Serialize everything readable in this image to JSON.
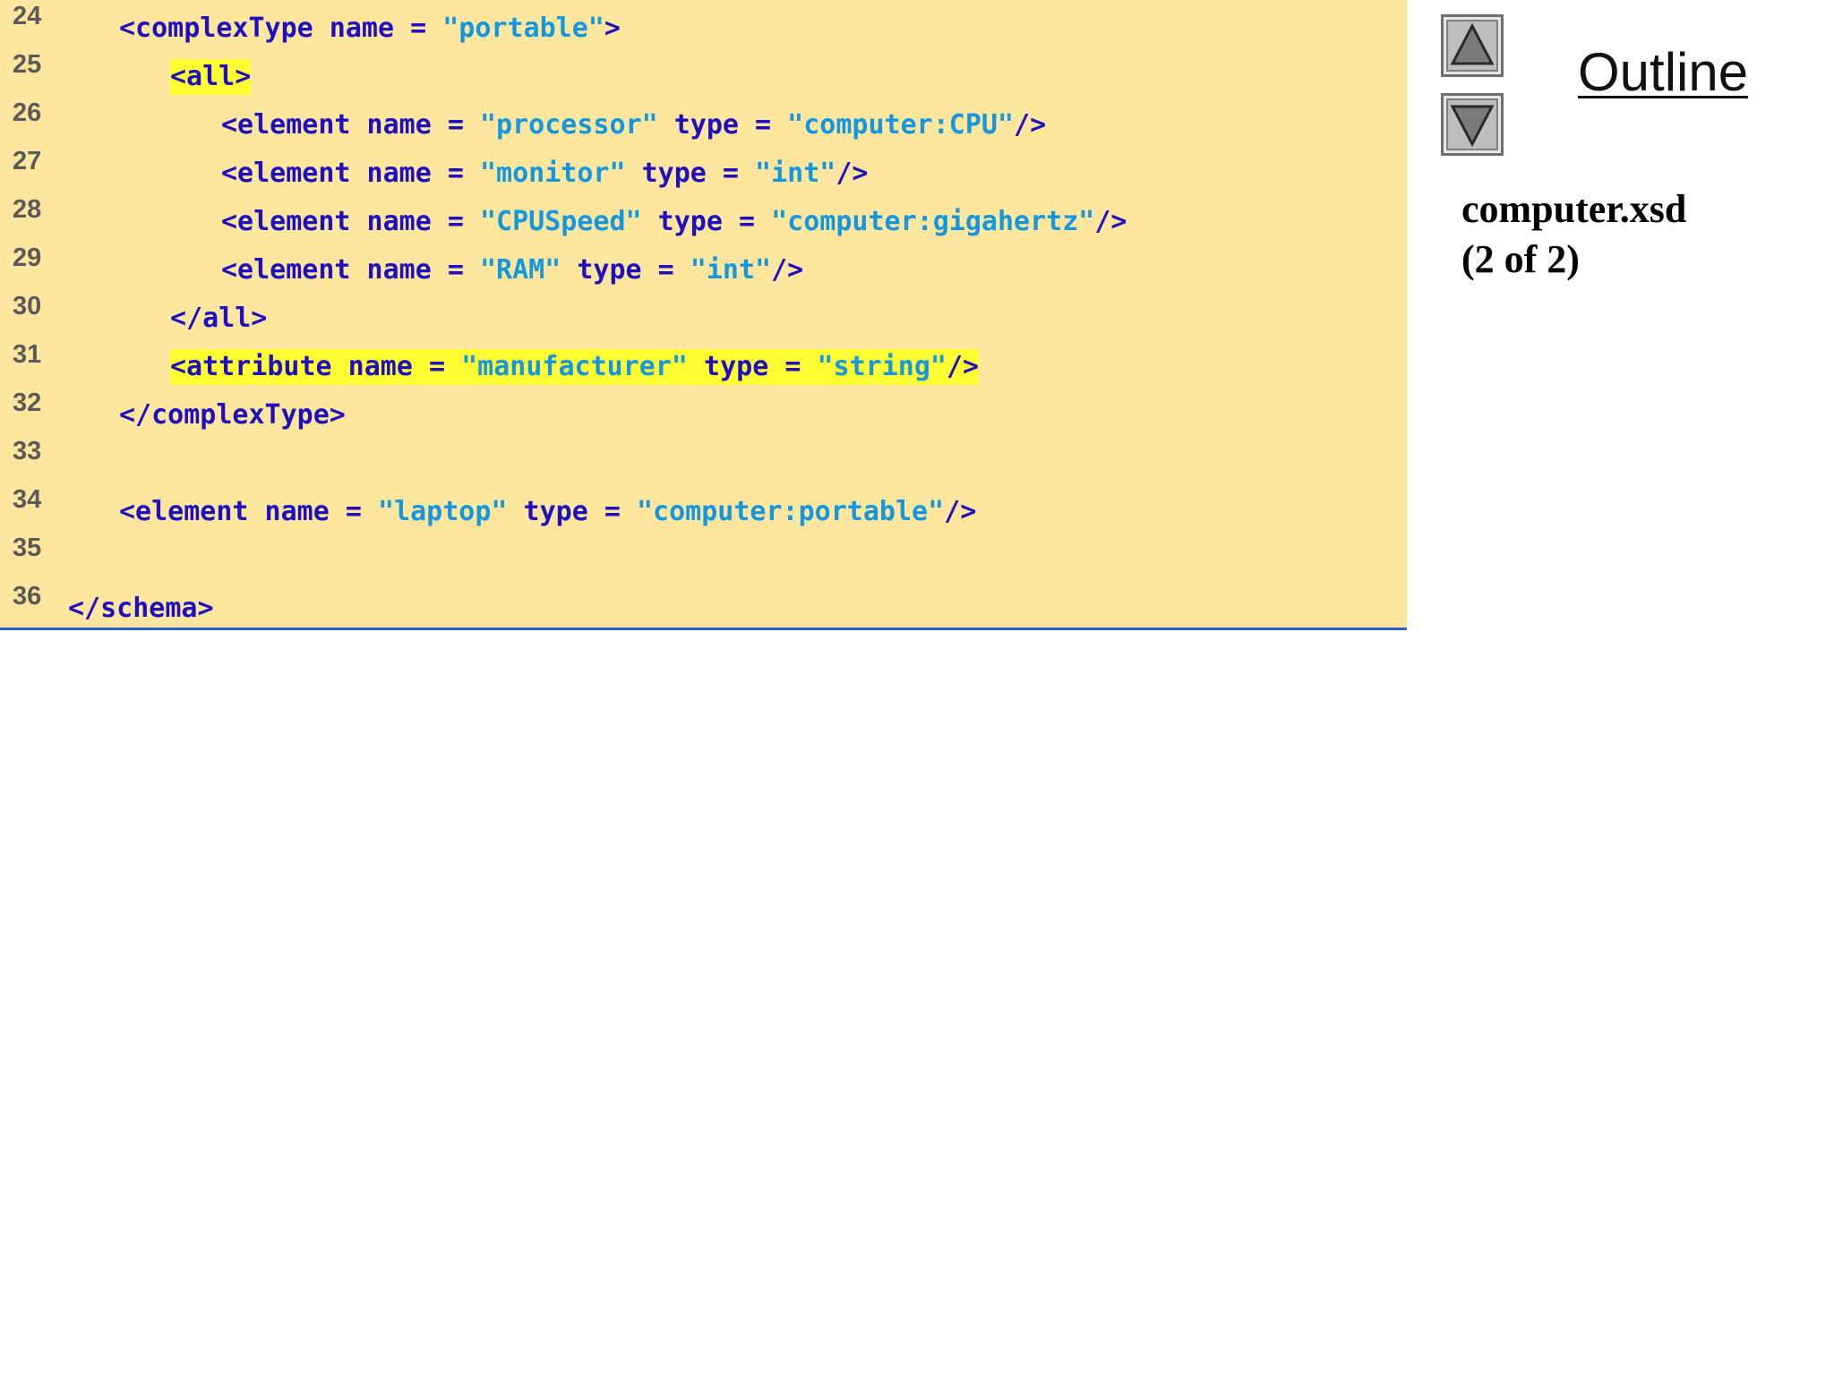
{
  "code": {
    "lines": [
      {
        "number": "24",
        "indent": 1,
        "segments": [
          {
            "t": "<complexType name = ",
            "c": "tag"
          },
          {
            "t": "\"portable\"",
            "c": "val"
          },
          {
            "t": ">",
            "c": "tag"
          }
        ]
      },
      {
        "number": "25",
        "indent": 2,
        "highlight": true,
        "segments": [
          {
            "t": "<all>",
            "c": "tag"
          }
        ]
      },
      {
        "number": "26",
        "indent": 3,
        "segments": [
          {
            "t": "<element name = ",
            "c": "tag"
          },
          {
            "t": "\"processor\"",
            "c": "val"
          },
          {
            "t": " type = ",
            "c": "tag"
          },
          {
            "t": "\"computer:CPU\"",
            "c": "val"
          },
          {
            "t": "/>",
            "c": "tag"
          }
        ]
      },
      {
        "number": "27",
        "indent": 3,
        "segments": [
          {
            "t": "<element name = ",
            "c": "tag"
          },
          {
            "t": "\"monitor\"",
            "c": "val"
          },
          {
            "t": " type = ",
            "c": "tag"
          },
          {
            "t": "\"int\"",
            "c": "val"
          },
          {
            "t": "/>",
            "c": "tag"
          }
        ]
      },
      {
        "number": "28",
        "indent": 3,
        "segments": [
          {
            "t": "<element name = ",
            "c": "tag"
          },
          {
            "t": "\"CPUSpeed\"",
            "c": "val"
          },
          {
            "t": " type = ",
            "c": "tag"
          },
          {
            "t": "\"computer:gigahertz\"",
            "c": "val"
          },
          {
            "t": "/>",
            "c": "tag"
          }
        ]
      },
      {
        "number": "29",
        "indent": 3,
        "segments": [
          {
            "t": "<element name = ",
            "c": "tag"
          },
          {
            "t": "\"RAM\"",
            "c": "val"
          },
          {
            "t": " type = ",
            "c": "tag"
          },
          {
            "t": "\"int\"",
            "c": "val"
          },
          {
            "t": "/>",
            "c": "tag"
          }
        ]
      },
      {
        "number": "30",
        "indent": 2,
        "segments": [
          {
            "t": "</all>",
            "c": "tag"
          }
        ]
      },
      {
        "number": "31",
        "indent": 2,
        "highlight": true,
        "segments": [
          {
            "t": "<attribute name = ",
            "c": "tag"
          },
          {
            "t": "\"manufacturer\"",
            "c": "val"
          },
          {
            "t": " type = ",
            "c": "tag"
          },
          {
            "t": "\"string\"",
            "c": "val"
          },
          {
            "t": "/>",
            "c": "tag"
          }
        ]
      },
      {
        "number": "32",
        "indent": 1,
        "segments": [
          {
            "t": "</complexType>",
            "c": "tag"
          }
        ]
      },
      {
        "number": "33",
        "indent": 0,
        "segments": []
      },
      {
        "number": "34",
        "indent": 1,
        "segments": [
          {
            "t": "<element name = ",
            "c": "tag"
          },
          {
            "t": "\"laptop\"",
            "c": "val"
          },
          {
            "t": " type = ",
            "c": "tag"
          },
          {
            "t": "\"computer:portable\"",
            "c": "val"
          },
          {
            "t": "/>",
            "c": "tag"
          }
        ]
      },
      {
        "number": "35",
        "indent": 0,
        "segments": []
      },
      {
        "number": "36",
        "indent": 0,
        "segments": [
          {
            "t": "</schema>",
            "c": "tag"
          }
        ]
      }
    ]
  },
  "sidebar": {
    "outline_label": "Outline",
    "caption_line1": "computer.xsd",
    "caption_line2": "(2 of 2)",
    "up_icon": "triangle-up-icon",
    "down_icon": "triangle-down-icon"
  },
  "colors": {
    "panel_background": "#fde69e",
    "tag_color": "#1f0fbf",
    "value_color": "#1597e0",
    "highlight": "#ffff33",
    "line_number_color": "#5a5a5a"
  }
}
